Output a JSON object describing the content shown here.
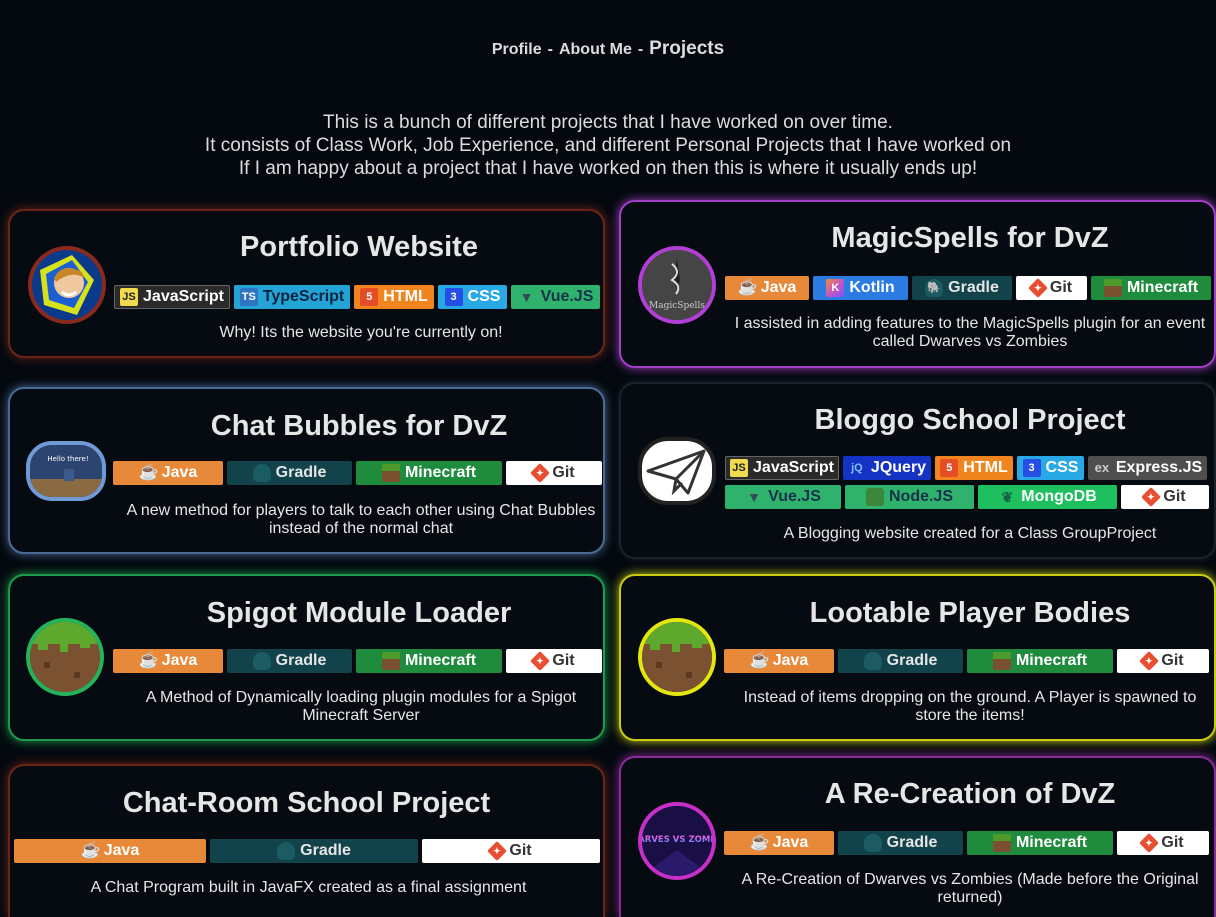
{
  "nav": {
    "items": [
      "Profile",
      "About Me",
      "Projects"
    ],
    "separator": "-"
  },
  "intro": {
    "lines": [
      "This is a bunch of different projects that I have worked on over time.",
      "It consists of Class Work, Job Experience, and different Personal Projects that I have worked on",
      "If I am happy about a project that I have worked on then this is where it usually ends up!"
    ]
  },
  "colors": {
    "background": "#04090f",
    "portfolio_glow": "#7a2a1a",
    "magicspells_glow": "#a23ec6",
    "chatbubbles_glow": "#5a7aa8",
    "bloggo_glow": "#1b2630",
    "spigot_glow": "#24b35a",
    "lootable_glow": "#e3e60f",
    "chatroom_glow": "#7a2a1a",
    "dvz_glow": "#a12aa8"
  },
  "projects": [
    {
      "title": "Portfolio Website",
      "icon": "portfolio-avatar-icon",
      "badges": [
        "JavaScript",
        "TypeScript",
        "HTML",
        "CSS",
        "Vue.JS"
      ],
      "description": "Why! Its the website you're currently on!"
    },
    {
      "title": "MagicSpells for DvZ",
      "icon": "magicspells-logo-icon",
      "icon_caption": "MagicSpells",
      "badges": [
        "Java",
        "Kotlin",
        "Gradle",
        "Git",
        "Minecraft"
      ],
      "description": "I assisted in adding features to the MagicSpells plugin for an event called Dwarves vs Zombies"
    },
    {
      "title": "Chat Bubbles for DvZ",
      "icon": "chat-bubble-screenshot-icon",
      "icon_caption": "Hello there!",
      "badges": [
        "Java",
        "Gradle",
        "Minecraft",
        "Git"
      ],
      "description": "A new method for players to talk to each other using Chat Bubbles instead of the normal chat"
    },
    {
      "title": "Bloggo School Project",
      "icon": "paper-plane-icon",
      "badges": [
        "JavaScript",
        "JQuery",
        "HTML",
        "CSS",
        "Express.JS",
        "Vue.JS",
        "Node.JS",
        "MongoDB",
        "Git"
      ],
      "description": "A Blogging website created for a Class GroupProject"
    },
    {
      "title": "Spigot Module Loader",
      "icon": "grass-block-icon",
      "badges": [
        "Java",
        "Gradle",
        "Minecraft",
        "Git"
      ],
      "description": "A Method of Dynamically loading plugin modules for a Spigot Minecraft Server"
    },
    {
      "title": "Lootable Player Bodies",
      "icon": "grass-block-icon",
      "badges": [
        "Java",
        "Gradle",
        "Minecraft",
        "Git"
      ],
      "description": "Instead of items dropping on the ground. A Player is spawned to store the items!"
    },
    {
      "title": "Chat-Room School Project",
      "badges": [
        "Java",
        "Gradle",
        "Git"
      ],
      "description": "A Chat Program built in JavaFX created as a final assignment"
    },
    {
      "title": "A Re-Creation of DvZ",
      "icon": "dwarves-vs-zombies-logo-icon",
      "icon_caption": "DWARVES VS ZOMBIES",
      "badges": [
        "Java",
        "Gradle",
        "Minecraft",
        "Git"
      ],
      "description": "A Re-Creation of Dwarves vs Zombies (Made before the Original returned)"
    }
  ],
  "badge_icons": {
    "JavaScript": "JS",
    "TypeScript": "TS",
    "HTML": "5",
    "CSS": "3",
    "Vue.JS": "▼",
    "Java": "☕",
    "Kotlin": "K",
    "Gradle": "🐘",
    "Git": "◆",
    "Minecraft": "▪",
    "JQuery": "jQ",
    "Express.JS": "ex",
    "Node.JS": "⬢",
    "MongoDB": "❦"
  }
}
